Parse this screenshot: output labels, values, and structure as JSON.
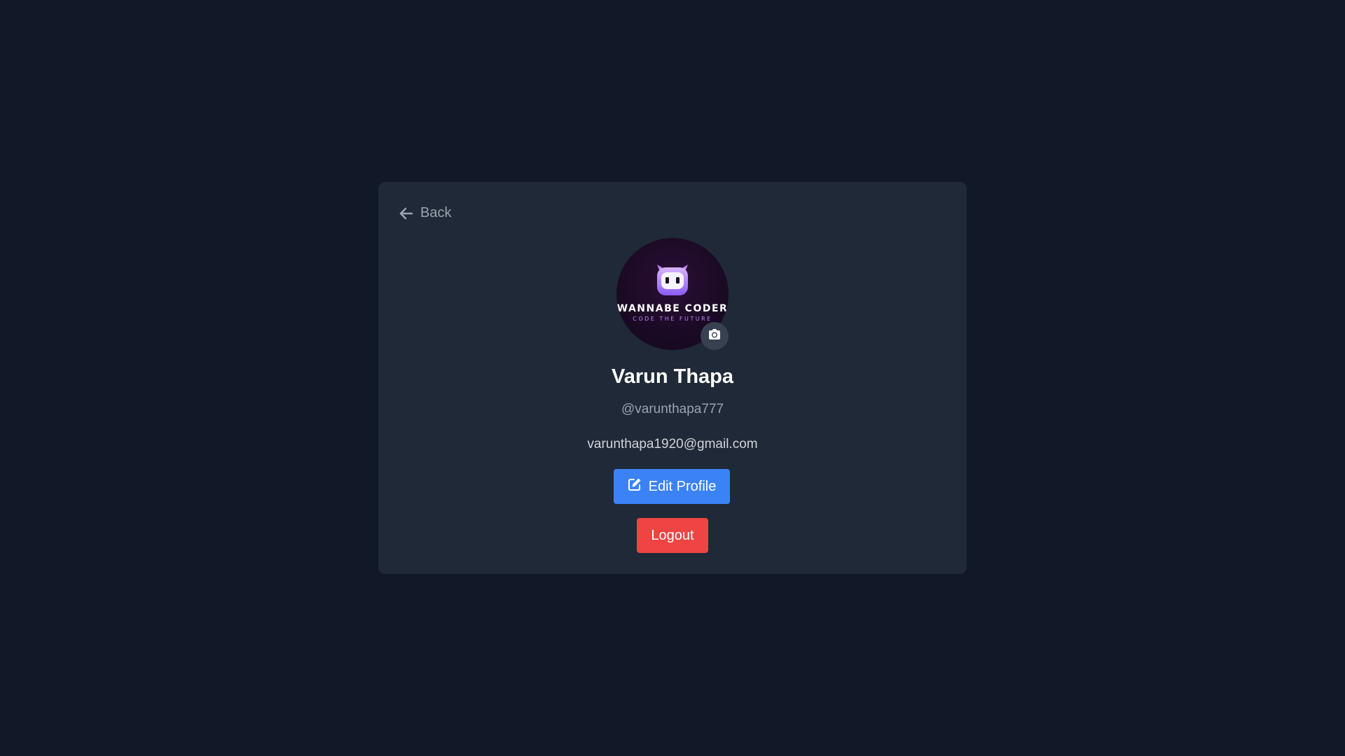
{
  "back": {
    "label": "Back",
    "icon": "arrow-left-icon"
  },
  "profile": {
    "avatar_logo_text": "WANNABE CODER",
    "avatar_logo_tagline": "CODE THE FUTURE",
    "camera_icon": "camera-icon",
    "name": "Varun Thapa",
    "username": "@varunthapa777",
    "email": "varunthapa1920@gmail.com"
  },
  "actions": {
    "edit_label": "Edit Profile",
    "edit_icon": "edit-icon",
    "logout_label": "Logout"
  },
  "colors": {
    "page_bg": "#111827",
    "card_bg": "#1f2937",
    "primary": "#3b82f6",
    "danger": "#ef4444"
  }
}
